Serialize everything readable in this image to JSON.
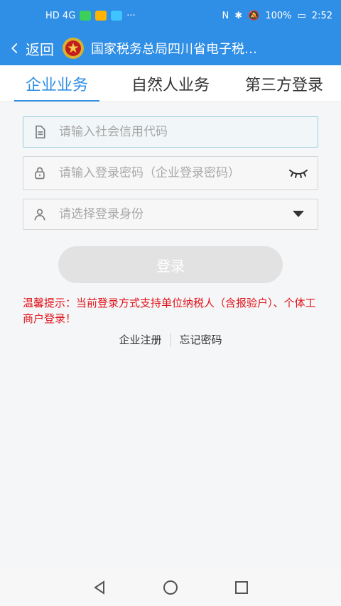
{
  "status_bar": {
    "battery": "100%",
    "time": "2:52",
    "network": "HD 4G"
  },
  "app_bar": {
    "back_label": "返回",
    "title": "国家税务总局四川省电子税…"
  },
  "tabs": [
    {
      "label": "企业业务",
      "active": true
    },
    {
      "label": "自然人业务",
      "active": false
    },
    {
      "label": "第三方登录",
      "active": false
    }
  ],
  "form": {
    "credit_code_placeholder": "请输入社会信用代码",
    "password_placeholder": "请输入登录密码（企业登录密码）",
    "identity_placeholder": "请选择登录身份"
  },
  "login_button_label": "登录",
  "tip": "温馨提示：当前登录方式支持单位纳税人（含报验户）、个体工商户登录！",
  "links": {
    "register": "企业注册",
    "forgot": "忘记密码"
  },
  "colors": {
    "primary": "#2f8ee5",
    "tip_red": "#e0141b",
    "button_disabled": "#e2e2e2"
  }
}
